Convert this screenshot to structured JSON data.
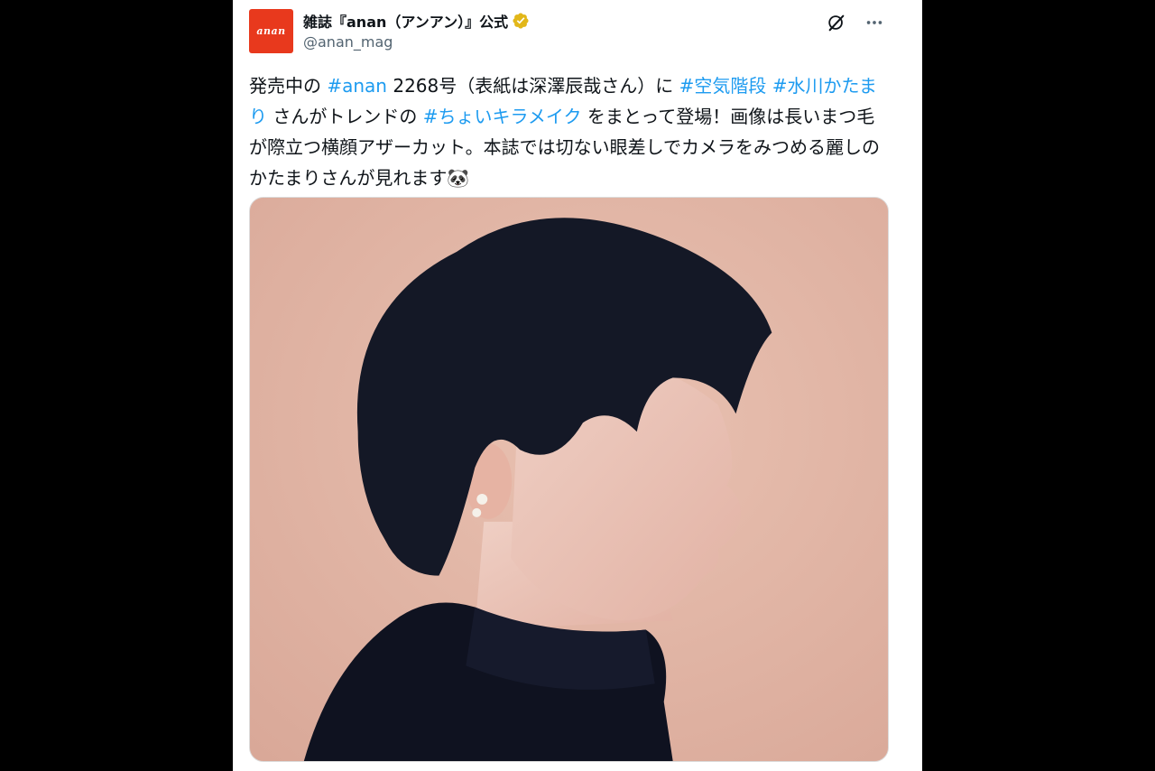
{
  "tweet": {
    "account": {
      "avatar_logo_text": "anan",
      "display_name": "雑誌『anan（アンアン）』公式",
      "handle": "@anan_mag",
      "verified_icon": "verified-badge-icon",
      "verified_color": "#e2b719"
    },
    "actions": {
      "grok_icon": "grok-icon",
      "more_icon": "more-icon"
    },
    "text_segments": [
      {
        "type": "text",
        "value": "発売中の "
      },
      {
        "type": "hashtag",
        "value": "#anan"
      },
      {
        "type": "text",
        "value": " 2268号（表紙は深澤辰哉さん）に "
      },
      {
        "type": "hashtag",
        "value": "#空気階段"
      },
      {
        "type": "text",
        "value": " "
      },
      {
        "type": "hashtag",
        "value": "#水川かたまり"
      },
      {
        "type": "text",
        "value": " さんがトレンドの "
      },
      {
        "type": "hashtag",
        "value": "#ちょいキラメイク"
      },
      {
        "type": "text",
        "value": " をまとって登場！画像は長いまつ毛が際立つ横顔アザーカット。本誌では切ない眼差しでカメラをみつめる麗しのかたまりさんが見れます🐼"
      }
    ],
    "media": {
      "description_icon": "portrait-photo"
    },
    "colors": {
      "link": "#1d9bf0",
      "text": "#0f1419",
      "muted": "#536471",
      "avatar_bg": "#e8391d",
      "photo_bg": "#e3b7a7"
    }
  }
}
